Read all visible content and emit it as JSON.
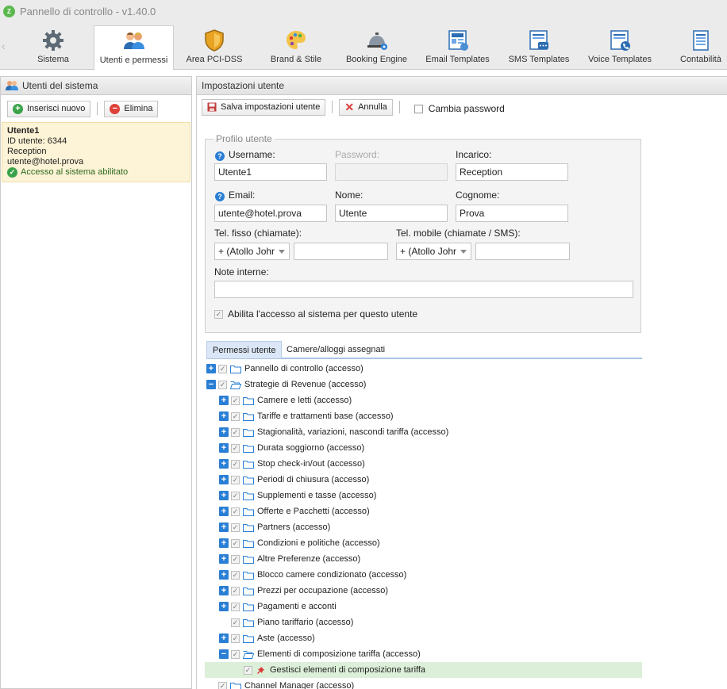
{
  "window": {
    "title": "Pannello di controllo - v1.40.0",
    "logo": "Z"
  },
  "tabs": [
    {
      "label": "Sistema",
      "icon": "gear-icon"
    },
    {
      "label": "Utenti e permessi",
      "icon": "users-icon",
      "active": true
    },
    {
      "label": "Area PCI-DSS",
      "icon": "shield-icon"
    },
    {
      "label": "Brand & Stile",
      "icon": "palette-icon"
    },
    {
      "label": "Booking Engine",
      "icon": "service-bell-icon"
    },
    {
      "label": "Email Templates",
      "icon": "email-template-icon"
    },
    {
      "label": "SMS Templates",
      "icon": "sms-template-icon"
    },
    {
      "label": "Voice Templates",
      "icon": "voice-template-icon"
    },
    {
      "label": "Contabilità",
      "icon": "accounting-icon"
    }
  ],
  "left": {
    "header": "Utenti del sistema",
    "add_label": "Inserisci nuovo",
    "delete_label": "Elimina",
    "user": {
      "name": "Utente1",
      "id_line": "ID utente: 6344",
      "role": "Reception",
      "email": "utente@hotel.prova",
      "status": "Accesso al sistema abilitato"
    }
  },
  "right": {
    "header": "Impostazioni utente",
    "save_label": "Salva impostazioni utente",
    "cancel_label": "Annulla",
    "change_password_label": "Cambia password",
    "profile": {
      "legend": "Profilo utente",
      "username_label": "Username:",
      "username_value": "Utente1",
      "password_label": "Password:",
      "role_label": "Incarico:",
      "role_value": "Reception",
      "email_label": "Email:",
      "email_value": "utente@hotel.prova",
      "firstname_label": "Nome:",
      "firstname_value": "Utente",
      "lastname_label": "Cognome:",
      "lastname_value": "Prova",
      "landline_label": "Tel. fisso (chiamate):",
      "landline_prefix": "+ (Atollo Johr",
      "mobile_label": "Tel. mobile (chiamate / SMS):",
      "mobile_prefix": "+ (Atollo Johr",
      "notes_label": "Note interne:",
      "enable_access_label": "Abilita l'accesso al sistema per questo utente"
    },
    "perm_tabs": [
      "Permessi utente",
      "Camere/alloggi assegnati"
    ],
    "tree": [
      {
        "label": "Pannello di controllo (accesso)",
        "level": 0,
        "toggle": "+",
        "folder": "closed"
      },
      {
        "label": "Strategie di Revenue (accesso)",
        "level": 0,
        "toggle": "-",
        "folder": "open"
      },
      {
        "label": "Camere e letti (accesso)",
        "level": 1,
        "toggle": "+",
        "folder": "closed"
      },
      {
        "label": "Tariffe e trattamenti base (accesso)",
        "level": 1,
        "toggle": "+",
        "folder": "closed"
      },
      {
        "label": "Stagionalità, variazioni, nascondi tariffa (accesso)",
        "level": 1,
        "toggle": "+",
        "folder": "closed"
      },
      {
        "label": "Durata soggiorno (accesso)",
        "level": 1,
        "toggle": "+",
        "folder": "closed"
      },
      {
        "label": "Stop check-in/out (accesso)",
        "level": 1,
        "toggle": "+",
        "folder": "closed"
      },
      {
        "label": "Periodi di chiusura (accesso)",
        "level": 1,
        "toggle": "+",
        "folder": "closed"
      },
      {
        "label": "Supplementi e tasse (accesso)",
        "level": 1,
        "toggle": "+",
        "folder": "closed"
      },
      {
        "label": "Offerte e Pacchetti (accesso)",
        "level": 1,
        "toggle": "+",
        "folder": "closed"
      },
      {
        "label": "Partners (accesso)",
        "level": 1,
        "toggle": "+",
        "folder": "closed"
      },
      {
        "label": "Condizioni e politiche (accesso)",
        "level": 1,
        "toggle": "+",
        "folder": "closed"
      },
      {
        "label": "Altre Preferenze (accesso)",
        "level": 1,
        "toggle": "+",
        "folder": "closed"
      },
      {
        "label": "Blocco camere condizionato (accesso)",
        "level": 1,
        "toggle": "+",
        "folder": "closed"
      },
      {
        "label": "Prezzi per occupazione (accesso)",
        "level": 1,
        "toggle": "+",
        "folder": "closed"
      },
      {
        "label": "Pagamenti e acconti",
        "level": 1,
        "toggle": "+",
        "folder": "closed"
      },
      {
        "label": "Piano tariffario (accesso)",
        "level": 1,
        "toggle": "",
        "folder": "closed"
      },
      {
        "label": "Aste (accesso)",
        "level": 1,
        "toggle": "+",
        "folder": "closed"
      },
      {
        "label": "Elementi di composizione tariffa (accesso)",
        "level": 1,
        "toggle": "-",
        "folder": "open"
      },
      {
        "label": "Gestisci elementi di composizione tariffa",
        "level": 2,
        "toggle": "",
        "folder": "pin",
        "highlight": true
      },
      {
        "label": "Channel Manager (accesso)",
        "level": 0,
        "toggle": "",
        "folder": "closed"
      }
    ]
  },
  "colors": {
    "accent": "#2a7fd4",
    "highlight": "#dcefd8",
    "selected_user": "#fdf3d6",
    "success": "#3aa34a",
    "danger": "#e0413a"
  }
}
